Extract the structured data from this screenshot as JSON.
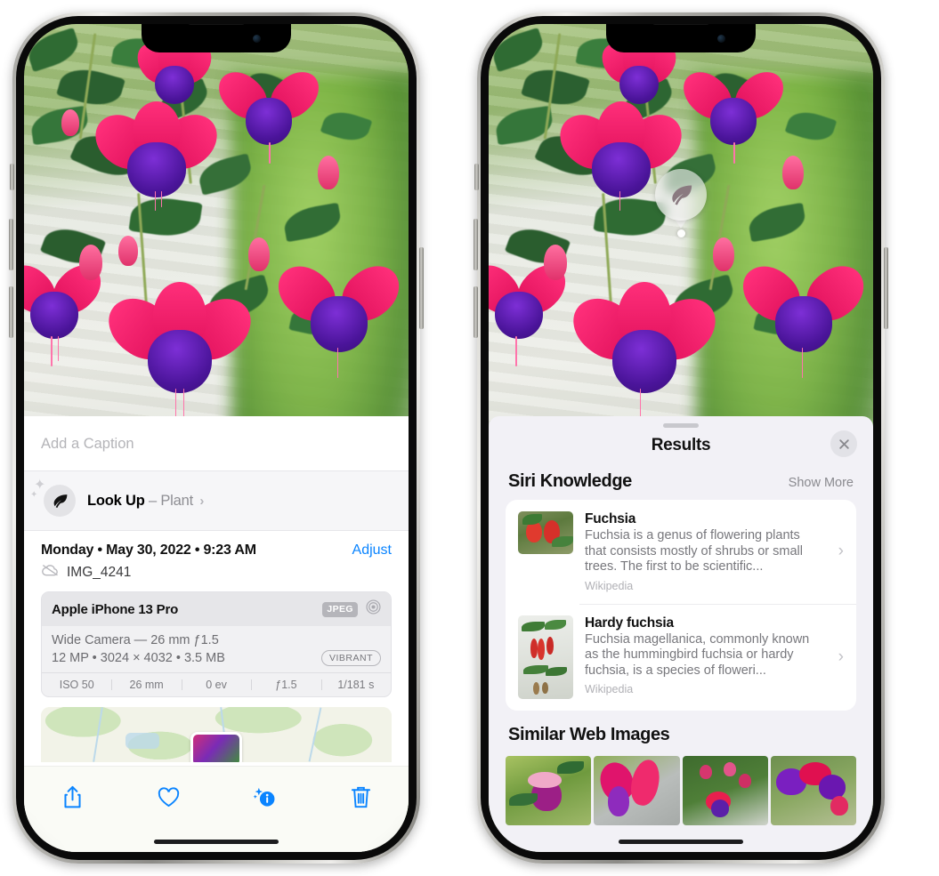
{
  "app": {
    "name": "Photos",
    "platform": "iOS",
    "accent_color": "#0a84ff"
  },
  "left_phone": {
    "screen_name": "photo-detail-info",
    "caption": {
      "placeholder": "Add a Caption",
      "value": ""
    },
    "look_up": {
      "icon": "leaf-icon",
      "label": "Look Up",
      "separator": "–",
      "subject": "Plant",
      "chevron": "›"
    },
    "photo_meta": {
      "date_line": "Monday • May 30, 2022 • 9:23 AM",
      "adjust_label": "Adjust",
      "cloud_icon": "cloud-slash-icon",
      "filename": "IMG_4241"
    },
    "exif": {
      "device": "Apple iPhone 13 Pro",
      "format_badge": "JPEG",
      "aperture_icon": "aperture-icon",
      "lens_line": "Wide Camera — 26 mm ƒ1.5",
      "specs_line": "12 MP • 3024 × 4032 • 3.5 MB",
      "style_badge": "VIBRANT",
      "stats": [
        "ISO 50",
        "26 mm",
        "0 ev",
        "ƒ1.5",
        "1/181 s"
      ]
    },
    "map": {
      "name": "location-map-preview",
      "pin": "photo-pin"
    },
    "toolbar": [
      {
        "name": "share-button",
        "icon": "share-icon"
      },
      {
        "name": "favorite-button",
        "icon": "heart-icon"
      },
      {
        "name": "info-button",
        "icon": "info-sparkle-icon",
        "active": true
      },
      {
        "name": "delete-button",
        "icon": "trash-icon"
      }
    ]
  },
  "right_phone": {
    "screen_name": "visual-look-up-results",
    "badge": {
      "icon": "leaf-icon",
      "name": "visual-look-up-badge"
    },
    "panel": {
      "title": "Results",
      "close_icon": "close-icon",
      "grabber": "drag-handle"
    },
    "siri_knowledge": {
      "title": "Siri Knowledge",
      "show_more": "Show More",
      "items": [
        {
          "title": "Fuchsia",
          "description": "Fuchsia is a genus of flowering plants that consists mostly of shrubs or small trees. The first to be scientific...",
          "source": "Wikipedia",
          "thumb": "fuchsia-thumbnail",
          "chevron": "›"
        },
        {
          "title": "Hardy fuchsia",
          "description": "Fuchsia magellanica, commonly known as the hummingbird fuchsia or hardy fuchsia, is a species of floweri...",
          "source": "Wikipedia",
          "thumb": "hardy-fuchsia-thumbnail",
          "chevron": "›"
        }
      ]
    },
    "similar_web_images": {
      "title": "Similar Web Images",
      "thumbs": [
        "similar-image-1",
        "similar-image-2",
        "similar-image-3",
        "similar-image-4"
      ]
    }
  }
}
